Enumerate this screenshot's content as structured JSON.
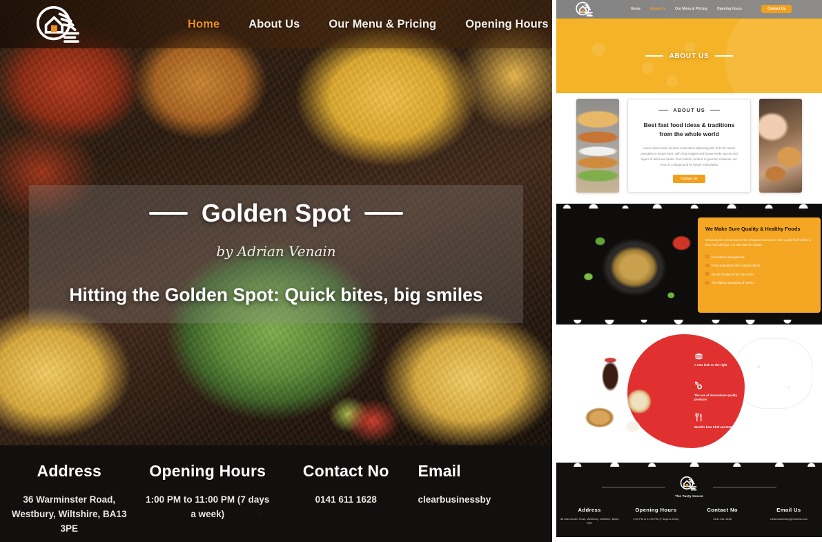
{
  "left_preview": {
    "nav": {
      "logo_name": "house-hand-logo",
      "links": [
        {
          "label": "Home",
          "active": true
        },
        {
          "label": "About Us",
          "active": false
        },
        {
          "label": "Our Menu & Pricing",
          "active": false
        },
        {
          "label": "Opening Hours",
          "active": false
        }
      ]
    },
    "hero": {
      "title": "Golden Spot",
      "byline": "by Adrian Venain",
      "tagline": "Hitting the Golden Spot: Quick bites, big smiles"
    },
    "footer": {
      "columns": [
        {
          "heading": "Address",
          "text": "36 Warminster Road, Westbury, Wiltshire, BA13 3PE"
        },
        {
          "heading": "Opening Hours",
          "text": "1:00 PM to 11:00 PM (7 days a week)"
        },
        {
          "heading": "Contact No",
          "text": "0141 611 1628"
        },
        {
          "heading": "Email",
          "text": "clearbusinessby"
        }
      ]
    }
  },
  "right_preview": {
    "nav": {
      "logo_name": "house-hand-logo",
      "links": [
        {
          "label": "Home",
          "active": false
        },
        {
          "label": "About Us",
          "active": true
        },
        {
          "label": "Our Menu & Pricing",
          "active": false
        },
        {
          "label": "Opening Hours",
          "active": false
        }
      ],
      "contact_button": "Contact Us"
    },
    "banner": {
      "title": "ABOUT US"
    },
    "about_card": {
      "eyebrow": "ABOUT US",
      "heading": "Best fast food ideas & traditions from the whole world",
      "body": "Lorem ipsum dolor sit amet consectetur adipiscing elit, from the sweet pancakes to burger buns, with crisp veggies and house-made sauces and layers of delicious meats. From classic combos to gourmet creations, our menu is a playground for burger enthusiasts.",
      "button": "Contact Us",
      "left_image_name": "chicken-burger-photo",
      "right_image_name": "woman-eating-burger-photo"
    },
    "quality": {
      "title": "We Make Sure Quality & Healthy Foods",
      "body": "Genuinely the overall team of the restaurant founded on both quality find healthy in their food offerings. It is also that the recipes.",
      "items": [
        "Food items management",
        "Fresh ingredients from organic farms",
        "We are located in the city center",
        "The highest standards of service"
      ],
      "dish_image_name": "shrimp-rice-dish-photo"
    },
    "features": {
      "blob_color": "#e03030",
      "items": [
        {
          "icon": "burger-icon",
          "glyph": "ἵ4",
          "label": "A new look on the right"
        },
        {
          "icon": "award-badge-icon",
          "glyph": "❁",
          "label": "The use of innovations quality products"
        },
        {
          "icon": "fork-knife-icon",
          "glyph": "ἷ4",
          "label": "World's best Chef and Nutritionist"
        }
      ],
      "food_image_name": "pizza-drink-burger-photo"
    },
    "footer": {
      "brand_name": "The Tasty House",
      "logo_name": "house-hand-logo",
      "columns": [
        {
          "heading": "Address",
          "text": "36 Warminster Road, Westbury, Wiltshire, BA13 3PE"
        },
        {
          "heading": "Opening Hours",
          "text": "1:00 PM to 11:00 PM (7 days a week)"
        },
        {
          "heading": "Contact No",
          "text": "0141 611 1628"
        },
        {
          "heading": "Email Us",
          "text": "clearbusinessby@hotmail.com"
        }
      ]
    }
  },
  "theme": {
    "accent_orange": "#e8911f",
    "banner_yellow": "#f5b327",
    "card_orange": "#f5a623",
    "blob_red": "#e03030",
    "dark": "#121110"
  }
}
